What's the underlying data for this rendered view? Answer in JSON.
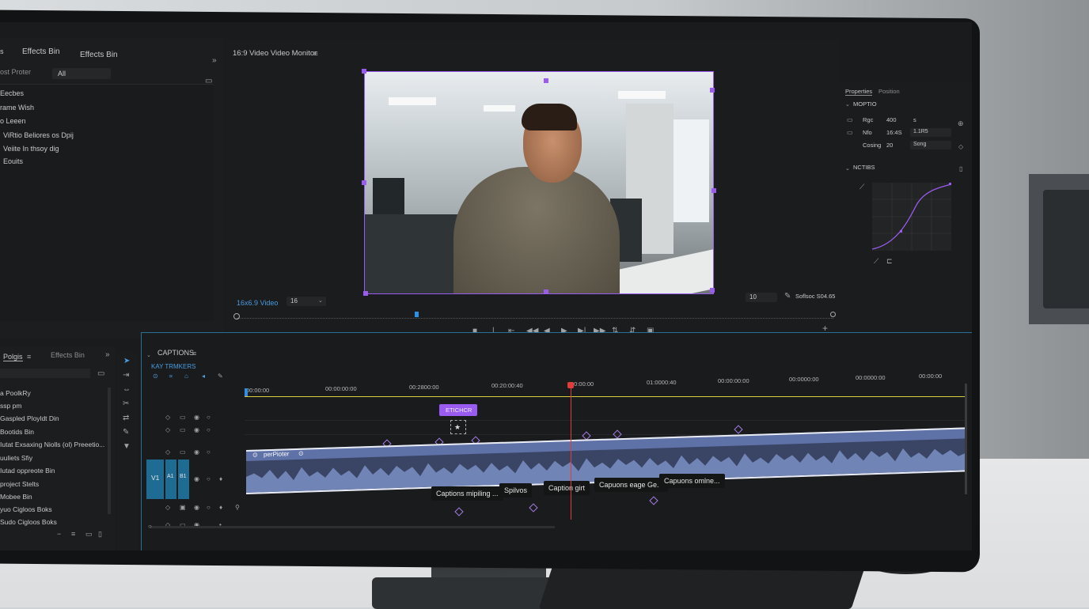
{
  "project_panel": {
    "tab_label": "Effects Bin",
    "tab_label_2": "Effects Bin",
    "search_label": "ost Proter",
    "filter_value": "All",
    "items": [
      "Eecbes",
      "rame Wish",
      "o Leeen",
      "ViRtio Beliores os Dpij",
      "Veiite In thsoy dig",
      "Eouits"
    ]
  },
  "monitor": {
    "title": "16:9 Video Video Monitor",
    "resolution_label": "16x6.9 Video",
    "zoom_value": "16",
    "right_value": "10",
    "settings_label": "Soflsoc S04.65"
  },
  "properties": {
    "tab_properties": "Properties",
    "tab_position": "Position",
    "section_motion": "MOPTIO",
    "rows": [
      {
        "label": "Rgc",
        "value": "400",
        "extra": "s"
      },
      {
        "label": "Nfo",
        "value": "16:4S",
        "extra": "1.1R5"
      },
      {
        "label": "Cosing",
        "value": "20",
        "extra": "Song"
      }
    ],
    "section_curve": "NCTIBS"
  },
  "bins_panel": {
    "tab_label": "Polgis",
    "tab_label_2": "Effects Bin",
    "items": [
      "a PoolkRy",
      "ssp pm",
      "Gaspled Ployldt Din",
      "Bootids Bin",
      "Iutat Exsaxing Niolls (ol) Preeetio...",
      "uuliets Sfiy",
      "Iutad oppreote Bin",
      "project Stelts",
      "Mobee Bin",
      "yuo Cigloos Boks",
      "Sudo Cigloos Boks"
    ]
  },
  "timeline": {
    "title": "CAPTIONS",
    "track_header_label": "KAY TRMKERS",
    "timecodes": [
      "00:00:00",
      "00:00:00:00",
      "00:2800:00",
      "00:20:00:40",
      "00:00:00",
      "01:0000:40",
      "00:00:00:00",
      "00:0000:00",
      "00:0000:00",
      "00:00:00"
    ],
    "clip_tag": "ETICHCR",
    "audio_clip_label": "perPioter",
    "track_v1": "V1",
    "track_a1": "A1",
    "track_b1": "B1",
    "captions": [
      "Captions mipiling ...",
      "Spilvos",
      "Caption girt",
      "Capuons eage Ge...",
      "Capuons omlne..."
    ]
  },
  "colors": {
    "accent": "#9a5cf0",
    "playhead": "#e03c3c",
    "marker": "#d8cf3a",
    "track_blue": "#1e6b93",
    "waveform": "#7b8fc4"
  }
}
